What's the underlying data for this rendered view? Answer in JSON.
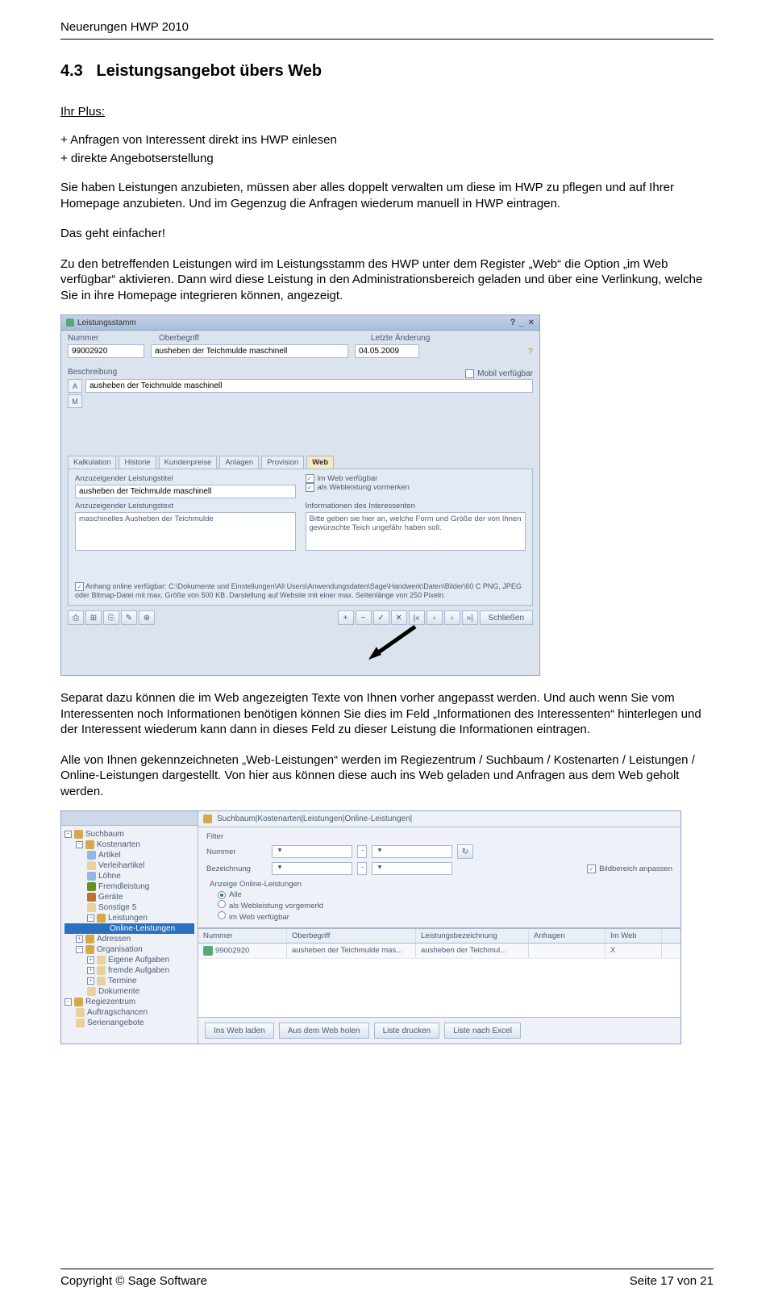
{
  "page_header": "Neuerungen HWP 2010",
  "section": {
    "number": "4.3",
    "title": "Leistungsangebot übers Web"
  },
  "plus": {
    "label": "Ihr Plus:",
    "items": [
      "+ Anfragen von Interessent direkt ins HWP einlesen",
      "+ direkte Angebotserstellung"
    ]
  },
  "paragraphs": {
    "p1": "Sie haben Leistungen anzubieten, müssen aber alles doppelt verwalten um diese im HWP zu pflegen und auf Ihrer Homepage anzubieten. Und im Gegenzug die Anfragen wiederum manuell in HWP eintragen.",
    "p2": "Das geht einfacher!",
    "p3": "Zu den betreffenden Leistungen wird im Leistungsstamm des HWP unter dem Register „Web“ die Option „im Web verfügbar“ aktivieren. Dann wird diese Leistung in den Administrationsbereich geladen und über eine Verlinkung, welche Sie in ihre Homepage integrieren können, angezeigt.",
    "p4": "Separat dazu können die im Web angezeigten Texte von Ihnen vorher angepasst werden. Und auch wenn Sie vom Interessenten noch Informationen benötigen können Sie dies im Feld „Informationen des Interessenten“ hinterlegen und der Interessent wiederum kann dann in dieses Feld zu dieser Leistung die Informationen eintragen.",
    "p5": "Alle von Ihnen gekennzeichneten „Web-Leistungen“ werden im Regiezentrum / Suchbaum / Kostenarten / Leistungen / Online-Leistungen dargestellt. Von hier aus können diese auch ins Web geladen und Anfragen aus dem Web geholt werden."
  },
  "s1": {
    "title": "Leistungsstamm",
    "labels": {
      "nummer": "Nummer",
      "oberbegriff": "Oberbegriff",
      "letzte": "Letzte Änderung"
    },
    "nummer": "99002920",
    "oberbegriff": "ausheben der Teichmulde maschinell",
    "letzte": "04.05.2009",
    "beschreibung_label": "Beschreibung",
    "mobil_label": "Mobil verfügbar",
    "desc_value": "ausheben der Teichmulde maschinell",
    "tabs": [
      "Kalkulation",
      "Historie",
      "Kundenpreise",
      "Anlagen",
      "Provision",
      "Web"
    ],
    "web": {
      "titel_label": "Anzuzeigender Leistungstitel",
      "titel_value": "ausheben der Teichmulde maschinell",
      "text_label": "Anzuzeigender Leistungstext",
      "text_value": "maschinelles Ausheben der Teichmulde",
      "cb1": "im Web verfügbar",
      "cb2": "als Webleistung vormerken",
      "info_label": "Informationen des Interessenten",
      "info_text": "Bitte geben sie hier an, welche Form und Größe der von Ihnen gewünschte Teich ungefähr haben soll.",
      "anhang": "Anhang online verfügbar:  C:\\Dokumente und Einstellungen\\All Users\\Anwendungsdaten\\Sage\\Handwerk\\Daten\\Bilder\\60 C PNG, JPEG oder Bitmap-Datei mit max. Größe von 500 KB. Darstellung auf Website mit einer max. Seitenlänge von 250 Pixeln."
    },
    "close": "Schließen"
  },
  "s2": {
    "breadcrumb": "Suchbaum|Kostenarten|Leistungen|Online-Leistungen|",
    "tree": {
      "root": "Suchbaum",
      "kostenarten": "Kostenarten",
      "artikel": "Artikel",
      "verleihartikel": "Verleihartikel",
      "loehne": "Löhne",
      "fremdleistung": "Fremdleistung",
      "geraete": "Geräte",
      "sonstige": "Sonstige 5",
      "leistungen": "Leistungen",
      "online_leistungen": "Online-Leistungen",
      "adressen": "Adressen",
      "organisation": "Organisation",
      "eigene": "Eigene Aufgaben",
      "fremde": "fremde Aufgaben",
      "termine": "Termine",
      "dokumente": "Dokumente",
      "regie": "Regiezentrum",
      "auft": "Auftragschancen",
      "serien": "Serienangebote"
    },
    "filter": {
      "title": "Filter",
      "nummer": "Nummer",
      "bezeichnung": "Bezeichnung",
      "bildbereich": "Bildbereich anpassen",
      "arg_title": "Anzeige Online-Leistungen",
      "r1": "Alle",
      "r2": "als Webleistung vorgemerkt",
      "r3": "im Web verfügbar"
    },
    "grid": {
      "cols": {
        "a": "Nummer",
        "b": "Oberbegriff",
        "c": "Leistungsbezeichnung",
        "d": "Anfragen",
        "e": "Im Web"
      },
      "row": {
        "a": "99002920",
        "b": "ausheben der Teichmulde mas...",
        "c": "ausheben der Teichmul...",
        "d": "",
        "e": "X"
      }
    },
    "buttons": {
      "b1": "Ins Web laden",
      "b2": "Aus dem Web holen",
      "b3": "Liste drucken",
      "b4": "Liste nach Excel"
    }
  },
  "footer": {
    "left": "Copyright © Sage Software",
    "right": "Seite 17 von 21"
  }
}
